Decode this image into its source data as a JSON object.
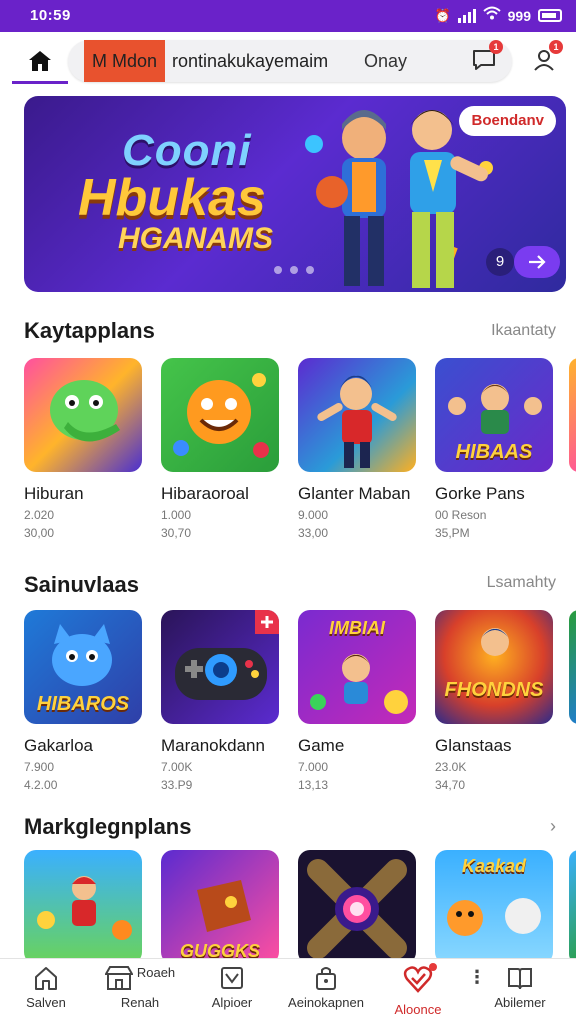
{
  "status_bar": {
    "time": "10:59",
    "right_text": "999"
  },
  "app_bar": {
    "search_tag": "M Mdon",
    "search_text": "rontinakukayemaim",
    "search_action": "Onay",
    "notif_badge": "1",
    "profile_badge": "1"
  },
  "banner": {
    "title_line1": "Cooni",
    "title_line2": "Hbukas",
    "title_line3": "HGANAMS",
    "cta_label": "Boendanv",
    "page_label": "9"
  },
  "sections": [
    {
      "title": "Kaytapplans",
      "link": "Ikaantaty",
      "items": [
        {
          "title": "Hiburan",
          "meta1": "2.020",
          "meta2": "30,00"
        },
        {
          "title": "Hibaraoroal",
          "meta1": "1.000",
          "meta2": "30,70"
        },
        {
          "title": "Glanter Maban",
          "meta1": "9.000",
          "meta2": "33,00"
        },
        {
          "title": "Gorke Pans",
          "meta1": "00 Reson",
          "meta2": "35,PM",
          "art_label": "HIBAAS"
        }
      ]
    },
    {
      "title": "Sainuvlaas",
      "link": "Lsamahty",
      "items": [
        {
          "title": "Gakarloa",
          "meta1": "7.900",
          "meta2": "4.2.00",
          "art_label": "HIBAROS"
        },
        {
          "title": "Maranokdann",
          "meta1": "7.00K",
          "meta2": "33.P9"
        },
        {
          "title": "Game",
          "meta1": "7.000",
          "meta2": "13,13",
          "art_label": "IMBIAI"
        },
        {
          "title": "Glanstaas",
          "meta1": "23.0K",
          "meta2": "34,70",
          "art_label": "FHONDNS"
        }
      ]
    },
    {
      "title": "Markglegnplans",
      "link": "›",
      "items": [
        {
          "title": "",
          "meta1": "",
          "meta2": ""
        },
        {
          "title": "",
          "meta1": "",
          "meta2": "",
          "art_label": "GUGGKS"
        },
        {
          "title": "",
          "meta1": "",
          "meta2": ""
        },
        {
          "title": "",
          "meta1": "",
          "meta2": "",
          "art_label": "Kaakad"
        }
      ]
    }
  ],
  "bottom_nav": [
    {
      "label": "Salven",
      "icon": "home-icon"
    },
    {
      "label": "Renah",
      "icon": "store-icon",
      "extra": "Roaeh"
    },
    {
      "label": "Alpioer",
      "icon": "download-icon"
    },
    {
      "label": "Aeinokapnen",
      "icon": "bag-icon"
    },
    {
      "label": "Aloonce",
      "icon": "heart-check-icon",
      "active": true
    },
    {
      "label": "Abilemer",
      "icon": "library-icon"
    }
  ],
  "colors": {
    "brand": "#6a22c9",
    "accent_red": "#d02a2a",
    "badge": "#e63a3a",
    "banner_start": "#3a1a8c",
    "banner_end": "#2f2a9e"
  }
}
